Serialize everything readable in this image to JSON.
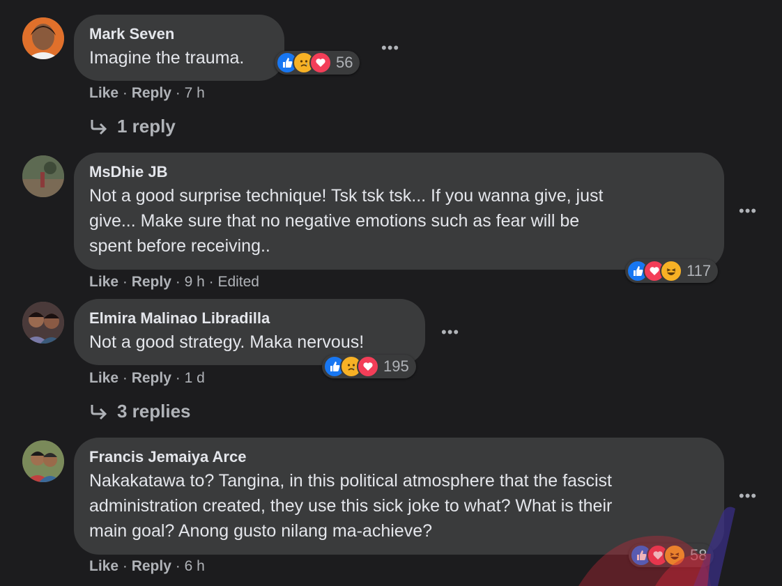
{
  "comments": [
    {
      "author": "Mark Seven",
      "lines": [
        "Imagine the trauma."
      ],
      "reaction_count": "56",
      "reactions": [
        "like",
        "sad",
        "love"
      ],
      "meta": {
        "like": "Like",
        "reply": "Reply",
        "time": "7 h",
        "edited": ""
      },
      "replies": "1 reply"
    },
    {
      "author": "MsDhie JB",
      "lines": [
        "Not a good surprise technique! Tsk tsk tsk... If you wanna give, just",
        "give... Make sure that no negative emotions such as fear will be",
        "spent before receiving.."
      ],
      "reaction_count": "117",
      "reactions": [
        "like",
        "love",
        "haha"
      ],
      "meta": {
        "like": "Like",
        "reply": "Reply",
        "time": "9 h",
        "edited": "Edited"
      },
      "replies": ""
    },
    {
      "author": "Elmira Malinao Libradilla",
      "lines": [
        "Not a good strategy. Maka nervous!"
      ],
      "reaction_count": "195",
      "reactions": [
        "like",
        "sad",
        "love"
      ],
      "meta": {
        "like": "Like",
        "reply": "Reply",
        "time": "1 d",
        "edited": ""
      },
      "replies": "3 replies"
    },
    {
      "author": "Francis Jemaiya Arce",
      "lines": [
        "Nakakatawa to? Tangina, in this political atmosphere that the fascist",
        "administration created, they use this sick joke to what? What is their",
        "main goal? Anong gusto nilang ma-achieve?"
      ],
      "reaction_count": "58",
      "reactions": [
        "like",
        "love",
        "haha"
      ],
      "meta": {
        "like": "Like",
        "reply": "Reply",
        "time": "6 h",
        "edited": ""
      },
      "replies": ""
    }
  ],
  "more_label": "•••",
  "colors": {
    "background": "#1c1c1e",
    "bubble": "#3a3b3c",
    "like": "#1877f2",
    "love": "#f33e58",
    "emoji": "#f7b125",
    "meta_text": "#b0b3b8"
  }
}
